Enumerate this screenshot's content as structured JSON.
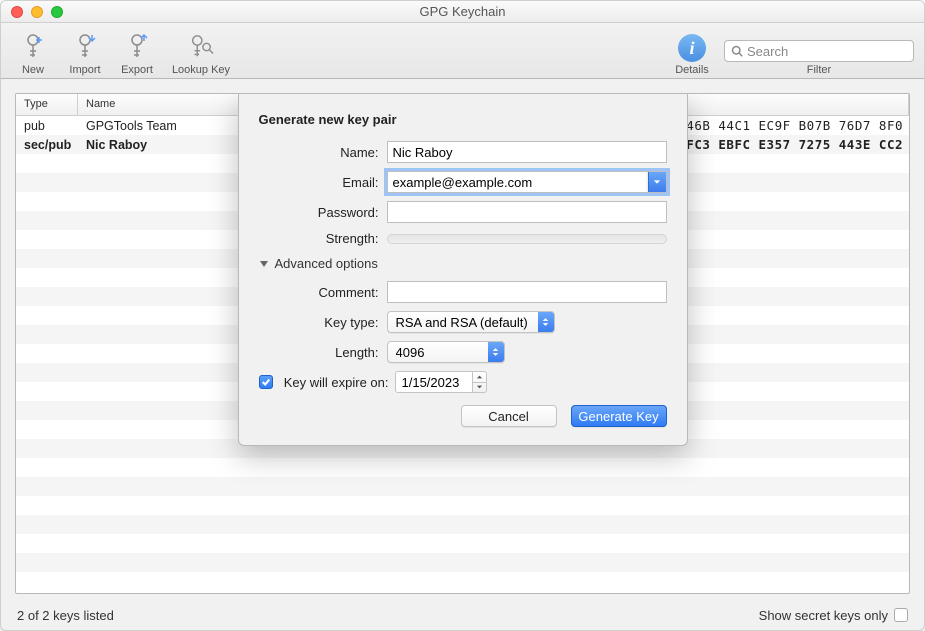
{
  "window": {
    "title": "GPG Keychain"
  },
  "toolbar": {
    "new": "New",
    "import": "Import",
    "export": "Export",
    "lookup": "Lookup Key",
    "details": "Details",
    "filter": "Filter",
    "search_placeholder": "Search"
  },
  "table": {
    "columns": {
      "type": "Type",
      "name": "Name"
    },
    "rows": [
      {
        "type": "pub",
        "name": "GPGTools Team",
        "fpr": "46B  44C1  EC9F   B07B  76D7  8F0",
        "bold": false
      },
      {
        "type": "sec/pub",
        "name": "Nic Raboy",
        "fpr": "FC3  EBFC  E357   7275  443E  CC2",
        "bold": true
      }
    ],
    "blank_rows": 22
  },
  "status": {
    "left": "2 of 2 keys listed",
    "show_secret": "Show secret keys only",
    "show_secret_checked": false
  },
  "sheet": {
    "title": "Generate new key pair",
    "labels": {
      "name": "Name:",
      "email": "Email:",
      "password": "Password:",
      "strength": "Strength:",
      "advanced": "Advanced options",
      "comment": "Comment:",
      "keytype": "Key type:",
      "length": "Length:",
      "expire": "Key will expire on:"
    },
    "values": {
      "name": "Nic Raboy",
      "email": "example@example.com",
      "password": "",
      "comment": "",
      "keytype": "RSA and RSA (default)",
      "length": "4096",
      "expire_checked": true,
      "expire_date": "1/15/2023"
    },
    "buttons": {
      "cancel": "Cancel",
      "generate": "Generate Key"
    }
  }
}
